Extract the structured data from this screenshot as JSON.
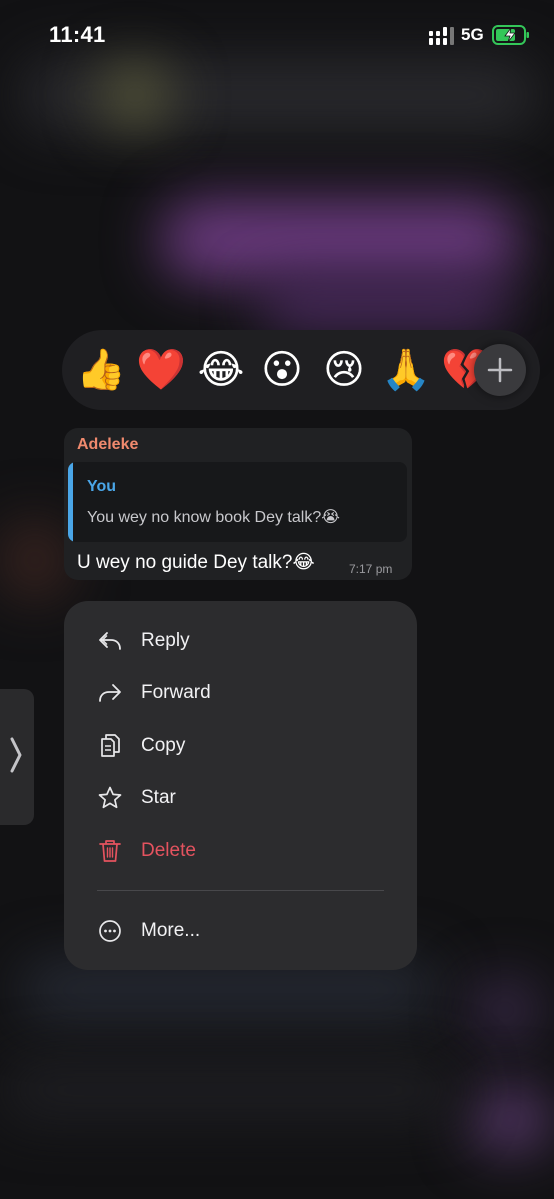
{
  "status_bar": {
    "time": "11:41",
    "network": "5G"
  },
  "reactions": {
    "emojis": [
      "👍",
      "❤️",
      "😂",
      "😮",
      "😢",
      "🙏",
      "💔"
    ]
  },
  "message": {
    "sender": "Adeleke",
    "quoted_sender": "You",
    "quoted_text": "You wey no know book Dey talk?😭",
    "text": "U wey no guide Dey talk?😂",
    "time": "7:17 pm"
  },
  "menu": {
    "reply": "Reply",
    "forward": "Forward",
    "copy": "Copy",
    "star": "Star",
    "delete": "Delete",
    "more": "More..."
  },
  "colors": {
    "sender": "#f08a6e",
    "quote_accent": "#4aa6e8",
    "danger": "#e5535f",
    "battery": "#34c759"
  }
}
